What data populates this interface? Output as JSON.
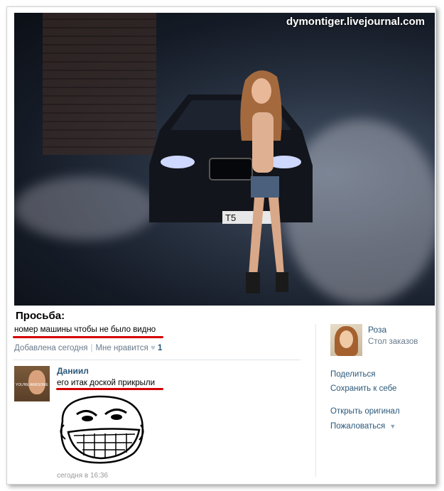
{
  "watermark": "dymontiger.livejournal.com",
  "post": {
    "title": "Просьба:",
    "text": "номер машины чтобы не было видно",
    "added": "Добавлена сегодня",
    "like_label": "Мне нравится",
    "like_count": "1",
    "license_plate": "Т5"
  },
  "comment": {
    "author": "Даниил",
    "text": "его итак доской прикрыли",
    "time": "сегодня в 16:36",
    "avatar_caption": "YOU'RE AWESOME"
  },
  "owner": {
    "name": "Роза",
    "subtitle": "Стол заказов"
  },
  "actions": {
    "share": "Поделиться",
    "save": "Сохранить к себе",
    "open_original": "Открыть оригинал",
    "report": "Пожаловаться"
  },
  "colors": {
    "link": "#2b587a",
    "meta": "#6b7b8c",
    "underline": "#d40000"
  }
}
